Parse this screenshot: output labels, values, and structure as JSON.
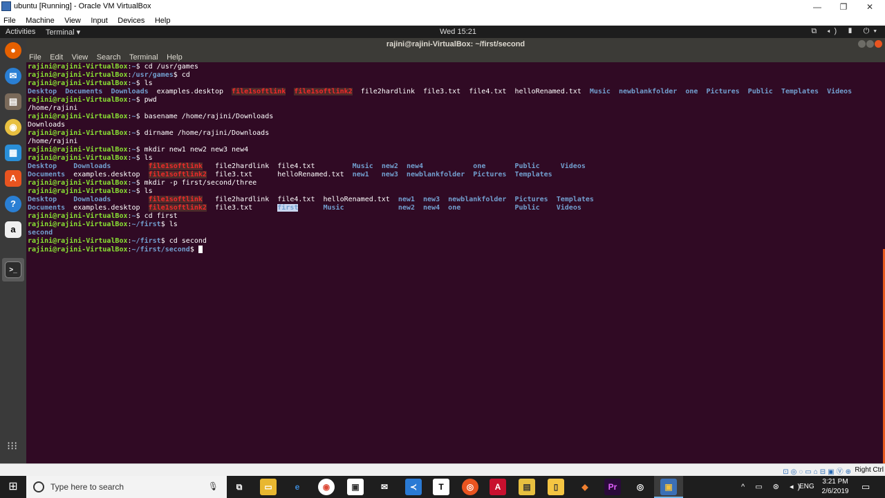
{
  "host_window": {
    "title": "ubuntu [Running] - Oracle VM VirtualBox",
    "controls": [
      "—",
      "❐",
      "✕"
    ],
    "menu": [
      "File",
      "Machine",
      "View",
      "Input",
      "Devices",
      "Help"
    ]
  },
  "gnome_topbar": {
    "activities": "Activities",
    "app_menu": "Terminal ▾",
    "clock": "Wed 15:21",
    "tray": "⧉ ◂) ▮ ⏻▾"
  },
  "terminal": {
    "title": "rajini@rajini-VirtualBox: ~/first/second",
    "menu": [
      "File",
      "Edit",
      "View",
      "Search",
      "Terminal",
      "Help"
    ],
    "lines": [
      [
        [
          "rajini@rajini-VirtualBox",
          "u"
        ],
        [
          ":",
          "f"
        ],
        [
          "~",
          "p"
        ],
        [
          "$ cd /usr/games",
          "f"
        ]
      ],
      [
        [
          "rajini@rajini-VirtualBox",
          "u"
        ],
        [
          ":",
          "f"
        ],
        [
          "/usr/games",
          "p"
        ],
        [
          "$ cd",
          "f"
        ]
      ],
      [
        [
          "rajini@rajini-VirtualBox",
          "u"
        ],
        [
          ":",
          "f"
        ],
        [
          "~",
          "p"
        ],
        [
          "$ ls",
          "f"
        ]
      ],
      [
        [
          "Desktop",
          "d"
        ],
        [
          "  ",
          "f"
        ],
        [
          "Documents",
          "d"
        ],
        [
          "  ",
          "f"
        ],
        [
          "Downloads",
          "d"
        ],
        [
          "  examples.desktop  ",
          "f"
        ],
        [
          "file1softlink",
          "l"
        ],
        [
          "  ",
          "f"
        ],
        [
          "file1softlink2",
          "l"
        ],
        [
          "  file2hardlink  file3.txt  file4.txt  helloRenamed.txt  ",
          "f"
        ],
        [
          "Music",
          "d"
        ],
        [
          "  ",
          "f"
        ],
        [
          "newblankfolder",
          "d"
        ],
        [
          "  ",
          "f"
        ],
        [
          "one",
          "d"
        ],
        [
          "  ",
          "f"
        ],
        [
          "Pictures",
          "d"
        ],
        [
          "  ",
          "f"
        ],
        [
          "Public",
          "d"
        ],
        [
          "  ",
          "f"
        ],
        [
          "Templates",
          "d"
        ],
        [
          "  ",
          "f"
        ],
        [
          "Videos",
          "d"
        ]
      ],
      [
        [
          "rajini@rajini-VirtualBox",
          "u"
        ],
        [
          ":",
          "f"
        ],
        [
          "~",
          "p"
        ],
        [
          "$ pwd",
          "f"
        ]
      ],
      [
        [
          "/home/rajini",
          "f"
        ]
      ],
      [
        [
          "rajini@rajini-VirtualBox",
          "u"
        ],
        [
          ":",
          "f"
        ],
        [
          "~",
          "p"
        ],
        [
          "$ basename /home/rajini/Downloads",
          "f"
        ]
      ],
      [
        [
          "Downloads",
          "f"
        ]
      ],
      [
        [
          "rajini@rajini-VirtualBox",
          "u"
        ],
        [
          ":",
          "f"
        ],
        [
          "~",
          "p"
        ],
        [
          "$ dirname /home/rajini/Downloads",
          "f"
        ]
      ],
      [
        [
          "/home/rajini",
          "f"
        ]
      ],
      [
        [
          "rajini@rajini-VirtualBox",
          "u"
        ],
        [
          ":",
          "f"
        ],
        [
          "~",
          "p"
        ],
        [
          "$ mkdir new1 new2 new3 new4",
          "f"
        ]
      ],
      [
        [
          "rajini@rajini-VirtualBox",
          "u"
        ],
        [
          ":",
          "f"
        ],
        [
          "~",
          "p"
        ],
        [
          "$ ls",
          "f"
        ]
      ],
      [
        [
          "Desktop",
          "d"
        ],
        [
          "    ",
          "f"
        ],
        [
          "Downloads",
          "d"
        ],
        [
          "         ",
          "f"
        ],
        [
          "file1softlink",
          "l"
        ],
        [
          "   file2hardlink  file4.txt         ",
          "f"
        ],
        [
          "Music",
          "d"
        ],
        [
          "  ",
          "f"
        ],
        [
          "new2",
          "d"
        ],
        [
          "  ",
          "f"
        ],
        [
          "new4",
          "d"
        ],
        [
          "            ",
          "f"
        ],
        [
          "one",
          "d"
        ],
        [
          "       ",
          "f"
        ],
        [
          "Public",
          "d"
        ],
        [
          "     ",
          "f"
        ],
        [
          "Videos",
          "d"
        ]
      ],
      [
        [
          "Documents",
          "d"
        ],
        [
          "  examples.desktop  ",
          "f"
        ],
        [
          "file1softlink2",
          "l"
        ],
        [
          "  file3.txt      helloRenamed.txt  ",
          "f"
        ],
        [
          "new1",
          "d"
        ],
        [
          "   ",
          "f"
        ],
        [
          "new3",
          "d"
        ],
        [
          "  ",
          "f"
        ],
        [
          "newblankfolder",
          "d"
        ],
        [
          "  ",
          "f"
        ],
        [
          "Pictures",
          "d"
        ],
        [
          "  ",
          "f"
        ],
        [
          "Templates",
          "d"
        ]
      ],
      [
        [
          "rajini@rajini-VirtualBox",
          "u"
        ],
        [
          ":",
          "f"
        ],
        [
          "~",
          "p"
        ],
        [
          "$ mkdir -p first/second/three",
          "f"
        ]
      ],
      [
        [
          "rajini@rajini-VirtualBox",
          "u"
        ],
        [
          ":",
          "f"
        ],
        [
          "~",
          "p"
        ],
        [
          "$ ls",
          "f"
        ]
      ],
      [
        [
          "Desktop",
          "d"
        ],
        [
          "    ",
          "f"
        ],
        [
          "Downloads",
          "d"
        ],
        [
          "         ",
          "f"
        ],
        [
          "file1softlink",
          "l"
        ],
        [
          "   file2hardlink  file4.txt  helloRenamed.txt  ",
          "f"
        ],
        [
          "new1",
          "d"
        ],
        [
          "  ",
          "f"
        ],
        [
          "new3",
          "d"
        ],
        [
          "  ",
          "f"
        ],
        [
          "newblankfolder",
          "d"
        ],
        [
          "  ",
          "f"
        ],
        [
          "Pictures",
          "d"
        ],
        [
          "  ",
          "f"
        ],
        [
          "Templates",
          "d"
        ]
      ],
      [
        [
          "Documents",
          "d"
        ],
        [
          "  examples.desktop  ",
          "f"
        ],
        [
          "file1softlink2",
          "l"
        ],
        [
          "  file3.txt      ",
          "f"
        ],
        [
          "first",
          "hl"
        ],
        [
          "      ",
          "f"
        ],
        [
          "Music",
          "d"
        ],
        [
          "             ",
          "f"
        ],
        [
          "new2",
          "d"
        ],
        [
          "  ",
          "f"
        ],
        [
          "new4",
          "d"
        ],
        [
          "  ",
          "f"
        ],
        [
          "one",
          "d"
        ],
        [
          "             ",
          "f"
        ],
        [
          "Public",
          "d"
        ],
        [
          "    ",
          "f"
        ],
        [
          "Videos",
          "d"
        ]
      ],
      [
        [
          "rajini@rajini-VirtualBox",
          "u"
        ],
        [
          ":",
          "f"
        ],
        [
          "~",
          "p"
        ],
        [
          "$ cd first",
          "f"
        ]
      ],
      [
        [
          "rajini@rajini-VirtualBox",
          "u"
        ],
        [
          ":",
          "f"
        ],
        [
          "~/first",
          "p"
        ],
        [
          "$ ls",
          "f"
        ]
      ],
      [
        [
          "second",
          "d"
        ]
      ],
      [
        [
          "rajini@rajini-VirtualBox",
          "u"
        ],
        [
          ":",
          "f"
        ],
        [
          "~/first",
          "p"
        ],
        [
          "$ cd second",
          "f"
        ]
      ],
      [
        [
          "rajini@rajini-VirtualBox",
          "u"
        ],
        [
          ":",
          "f"
        ],
        [
          "~/first/second",
          "p"
        ],
        [
          "$ ",
          "f"
        ]
      ]
    ]
  },
  "vbox_status": {
    "host_key": "Right Ctrl",
    "icons": "⊡◎◌▭⌂⊟▣Ⓥ⊕"
  },
  "taskbar": {
    "search_placeholder": "Type here to search",
    "tray_icons": "^ ▭ ⊛ ◂)",
    "language": "ENG",
    "time": "3:21 PM",
    "date": "2/6/2019"
  },
  "colors": {
    "terminal_bg": "#300a24",
    "prompt_user": "#8ae234",
    "directory": "#729fcf",
    "broken_link": "#ef2929"
  }
}
